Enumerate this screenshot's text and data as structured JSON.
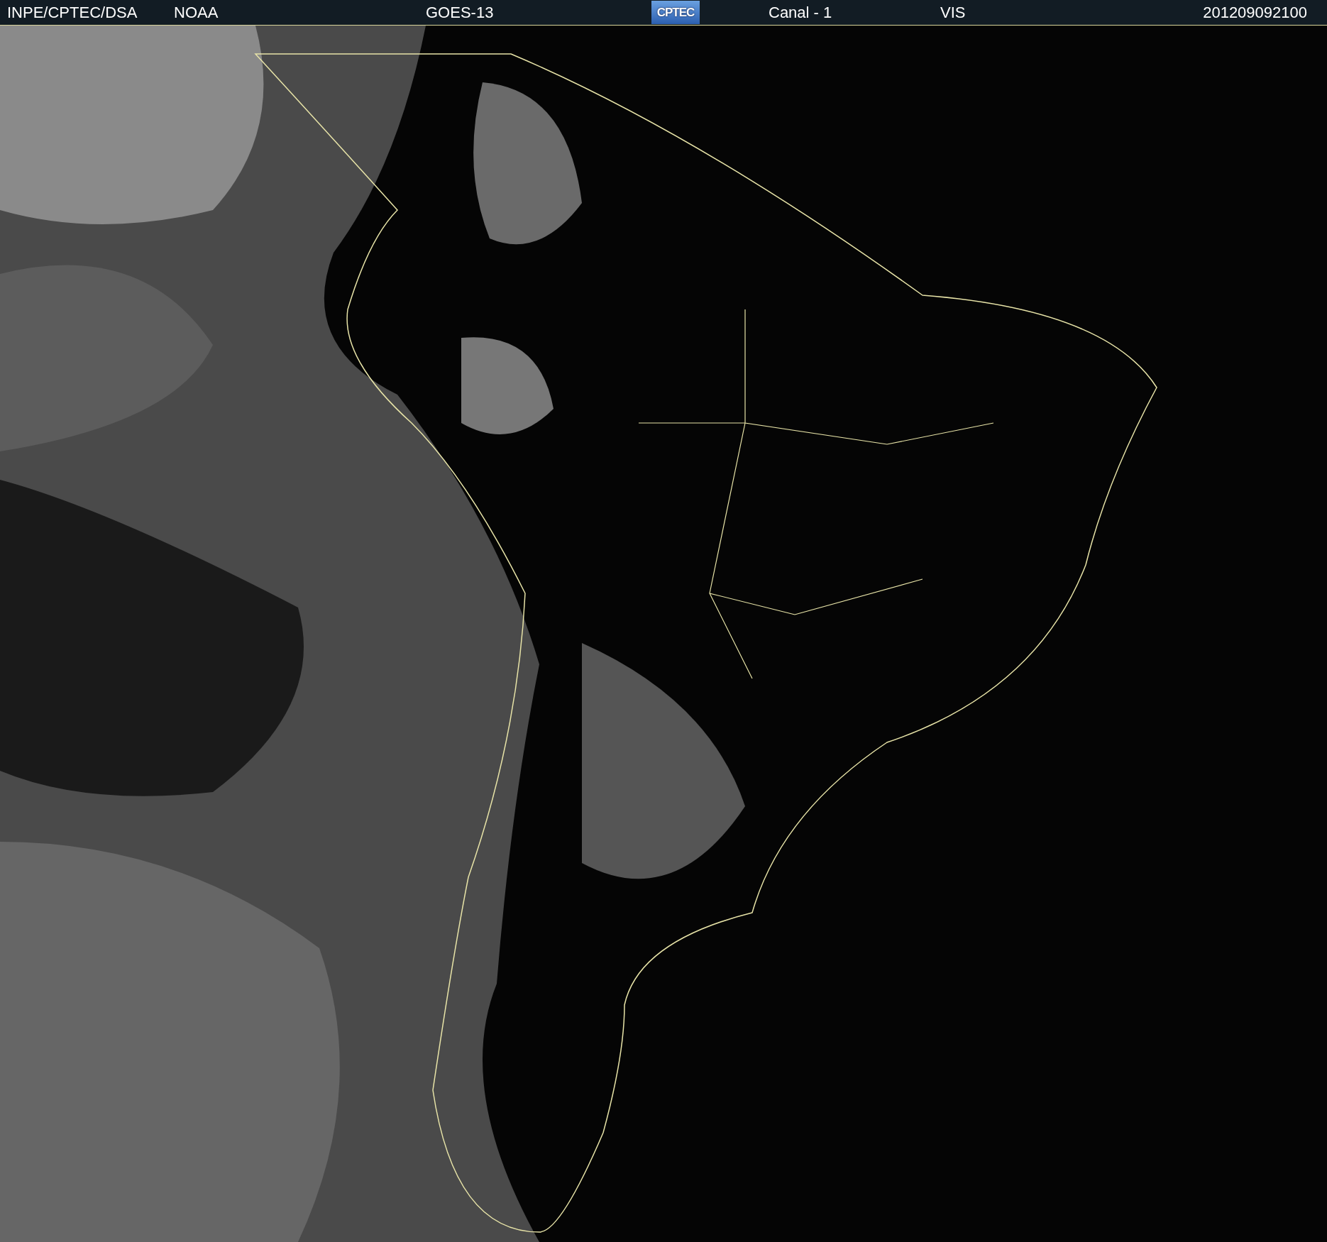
{
  "header": {
    "source": "INPE/CPTEC/DSA",
    "agency": "NOAA",
    "satellite": "GOES-13",
    "logo": "CPTEC",
    "channel": "Canal - 1",
    "band": "VIS",
    "timestamp": "201209092100"
  }
}
